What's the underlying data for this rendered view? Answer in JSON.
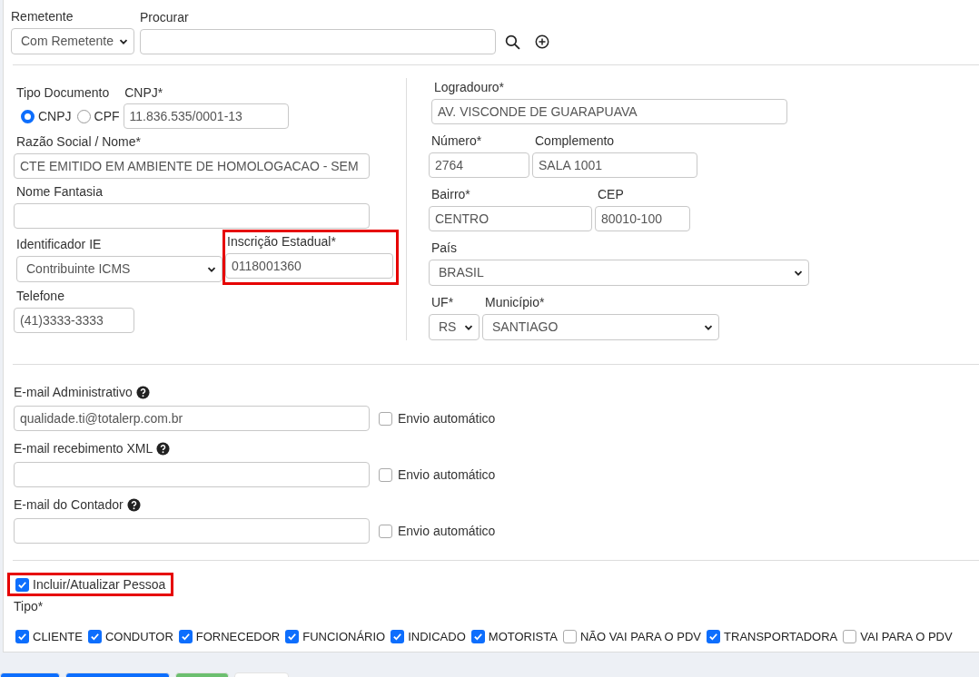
{
  "remetente": {
    "label": "Remetente",
    "value": "Com Remetente"
  },
  "procurar": {
    "label": "Procurar"
  },
  "tipo_documento": {
    "label": "Tipo Documento",
    "options": [
      {
        "label": "CNPJ",
        "selected": true
      },
      {
        "label": "CPF",
        "selected": false
      }
    ]
  },
  "cnpj": {
    "label": "CNPJ*",
    "value": "11.836.535/0001-13"
  },
  "razao_social": {
    "label": "Razão Social / Nome*",
    "value": "CTE EMITIDO EM AMBIENTE DE HOMOLOGACAO - SEM"
  },
  "nome_fantasia": {
    "label": "Nome Fantasia"
  },
  "identificador_ie": {
    "label": "Identificador IE",
    "value": "Contribuinte ICMS"
  },
  "inscricao_estadual": {
    "label": "Inscrição Estadual*",
    "value": "0118001360",
    "highlighted": true
  },
  "telefone": {
    "label": "Telefone",
    "value": "(41)3333-3333"
  },
  "logradouro": {
    "label": "Logradouro*",
    "value": "AV. VISCONDE DE GUARAPUAVA"
  },
  "numero": {
    "label": "Número*",
    "value": "2764"
  },
  "complemento": {
    "label": "Complemento",
    "value": "SALA 1001"
  },
  "bairro": {
    "label": "Bairro*",
    "value": "CENTRO"
  },
  "cep": {
    "label": "CEP",
    "value": "80010-100"
  },
  "pais": {
    "label": "País",
    "value": "BRASIL"
  },
  "uf": {
    "label": "UF*",
    "value": "RS"
  },
  "municipio": {
    "label": "Município*",
    "value": "SANTIAGO"
  },
  "emails": [
    {
      "label": "E-mail Administrativo",
      "value": "qualidade.ti@totalerp.com.br",
      "auto_label": "Envio automático",
      "auto": false
    },
    {
      "label": "E-mail recebimento XML",
      "auto_label": "Envio automático",
      "auto": false
    },
    {
      "label": "E-mail do Contador",
      "auto_label": "Envio automático",
      "auto": false
    }
  ],
  "incluir_pessoa": {
    "label": "Incluir/Atualizar Pessoa",
    "checked": true,
    "highlighted": true
  },
  "tipo": {
    "label": "Tipo*",
    "options": [
      {
        "label": "CLIENTE",
        "checked": true
      },
      {
        "label": "CONDUTOR",
        "checked": true
      },
      {
        "label": "FORNECEDOR",
        "checked": true
      },
      {
        "label": "FUNCIONÁRIO",
        "checked": true
      },
      {
        "label": "INDICADO",
        "checked": true
      },
      {
        "label": "MOTORISTA",
        "checked": true
      },
      {
        "label": "NÃO VAI PARA O PDV",
        "checked": false
      },
      {
        "label": "TRANSPORTADORA",
        "checked": true
      },
      {
        "label": "VAI PARA O PDV",
        "checked": false
      }
    ]
  },
  "footer_buttons": [
    {
      "color": "#0d6efd"
    },
    {
      "color": "#0d6efd"
    },
    {
      "color": "#6cbf6f"
    },
    {
      "color": "#ffffff"
    }
  ]
}
